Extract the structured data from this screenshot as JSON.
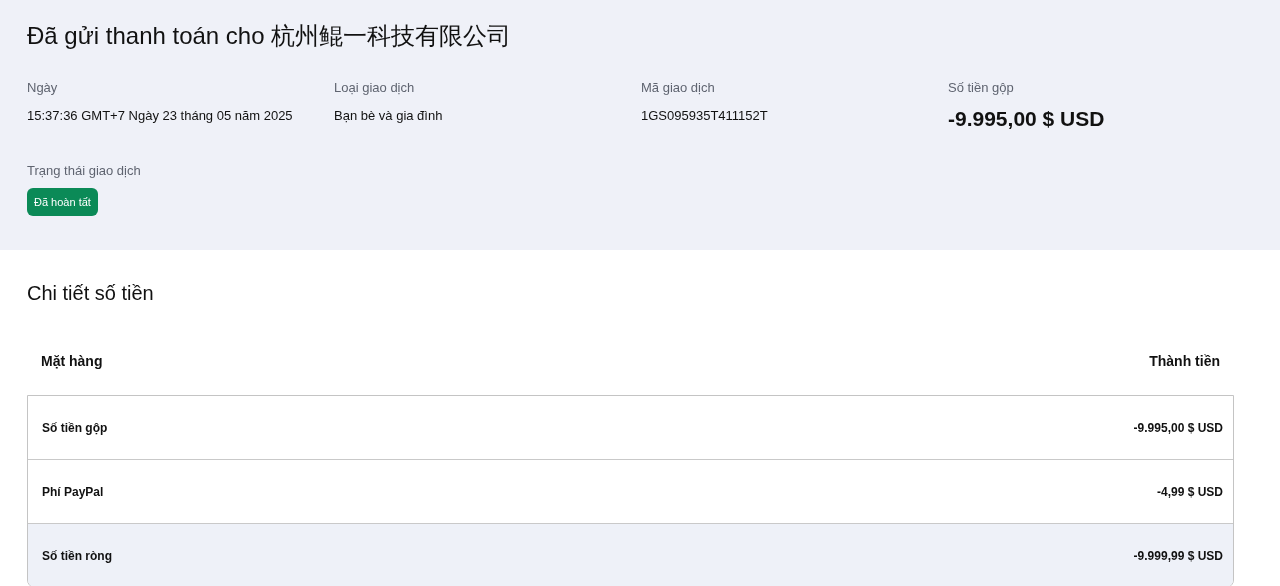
{
  "header": {
    "title": "Đã gửi thanh toán cho 杭州鲲一科技有限公司",
    "fields": [
      {
        "label": "Ngày",
        "value": "15:37:36 GMT+7 Ngày 23 tháng 05 năm 2025",
        "kind": "text"
      },
      {
        "label": "Loại giao dịch",
        "value": "Bạn bè và gia đình",
        "kind": "text"
      },
      {
        "label": "Mã giao dịch",
        "value": "1GS095935T411152T",
        "kind": "text"
      },
      {
        "label": "Số tiền gộp",
        "value": "-9.995,00 $ USD",
        "kind": "amount"
      }
    ],
    "status": {
      "label": "Trạng thái giao dịch",
      "badge": "Đã hoàn tất",
      "color": "#0b8a57"
    }
  },
  "details": {
    "title": "Chi tiết số tiền",
    "columns": [
      "Mặt hàng",
      "Thành tiền"
    ],
    "rows": [
      {
        "item": "Số tiền gộp",
        "amount": "-9.995,00 $ USD",
        "highlighted": false
      },
      {
        "item": "Phí PayPal",
        "amount": "-4,99 $ USD",
        "highlighted": false
      },
      {
        "item": "Số tiền ròng",
        "amount": "-9.999,99 $ USD",
        "highlighted": true
      }
    ]
  }
}
